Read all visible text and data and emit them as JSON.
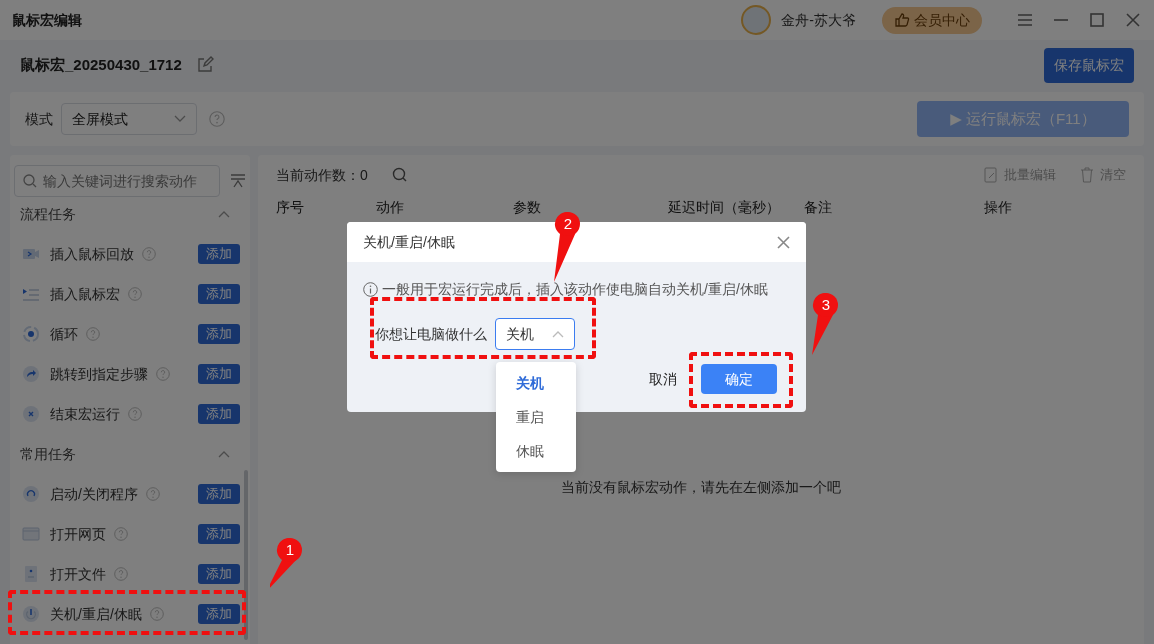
{
  "window": {
    "title": "鼠标宏编辑",
    "user_name": "金舟-苏大爷",
    "vip_button": "会员中心"
  },
  "macro": {
    "name": "鼠标宏_20250430_1712",
    "save_button": "保存鼠标宏"
  },
  "mode": {
    "label": "模式",
    "value": "全屏模式",
    "run_button": {
      "icon": "▶",
      "label": "运行鼠标宏（F11）",
      "disabled": true
    }
  },
  "sidebar": {
    "search_placeholder": "输入关键词进行搜索动作",
    "sections": [
      {
        "title": "流程任务",
        "expanded": true,
        "items": [
          {
            "label": "插入鼠标回放",
            "kind": "video",
            "button": "添加"
          },
          {
            "label": "插入鼠标宏",
            "kind": "list",
            "button": "添加"
          },
          {
            "label": "循环",
            "kind": "loop",
            "button": "添加"
          },
          {
            "label": "跳转到指定步骤",
            "kind": "jump",
            "button": "添加"
          },
          {
            "label": "结束宏运行",
            "kind": "stop",
            "button": "添加"
          }
        ]
      },
      {
        "title": "常用任务",
        "expanded": true,
        "items": [
          {
            "label": "启动/关闭程序",
            "kind": "program",
            "button": "添加"
          },
          {
            "label": "打开网页",
            "kind": "webpage",
            "button": "添加"
          },
          {
            "label": "打开文件",
            "kind": "file",
            "button": "添加"
          },
          {
            "label": "关机/重启/休眠",
            "kind": "power",
            "button": "添加"
          }
        ]
      }
    ]
  },
  "actions": {
    "count_label": "当前动作数：0",
    "batch_edit": "批量编辑",
    "clear": "清空",
    "columns": [
      "序号",
      "动作",
      "参数",
      "延迟时间（毫秒）",
      "备注",
      "操作"
    ],
    "empty_message": "当前没有鼠标宏动作，请先在左侧添加一个吧"
  },
  "dialog": {
    "title": "关机/重启/休眠",
    "info": "一般用于宏运行完成后，插入该动作使电脑自动关机/重启/休眠",
    "field_label": "你想让电脑做什么",
    "value": "关机",
    "options": [
      {
        "label": "关机",
        "selected": true
      },
      {
        "label": "重启",
        "selected": false
      },
      {
        "label": "休眠",
        "selected": false
      }
    ],
    "cancel": "取消",
    "ok": "确定"
  },
  "annotations": [
    {
      "number": "1"
    },
    {
      "number": "2"
    },
    {
      "number": "3"
    }
  ]
}
